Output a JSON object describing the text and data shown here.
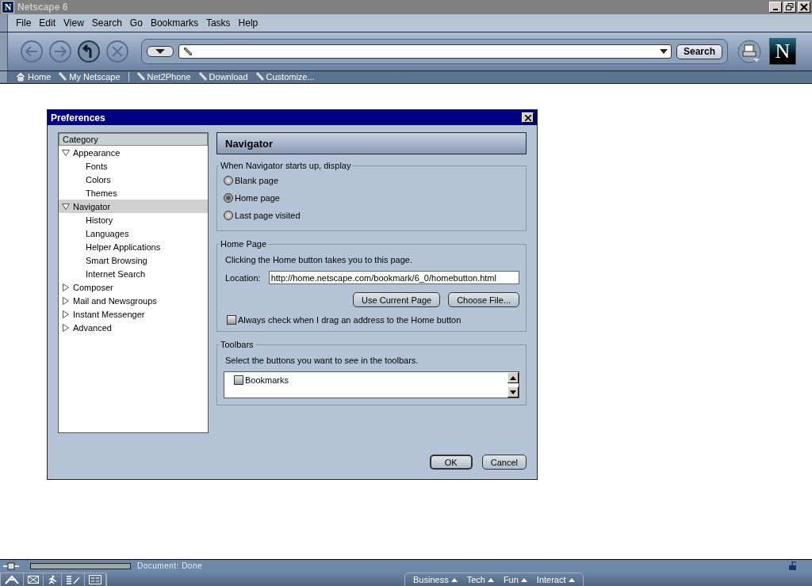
{
  "window": {
    "title": "Netscape 6",
    "logo_letter": "N"
  },
  "brand_logo_letter": "N",
  "progress": {
    "level": 1
  },
  "menu": [
    "File",
    "Edit",
    "View",
    "Search",
    "Go",
    "Bookmarks",
    "Tasks",
    "Help"
  ],
  "search_button": "Search",
  "personal_toolbar": [
    {
      "label": "Home",
      "kind": "home"
    },
    {
      "label": "My Netscape",
      "kind": "bookmark"
    },
    {
      "label": "Net2Phone",
      "kind": "bookmark"
    },
    {
      "label": "Download",
      "kind": "bookmark"
    },
    {
      "label": "Customize...",
      "kind": "bookmark"
    }
  ],
  "dialog": {
    "title": "Preferences",
    "category_header": "Category",
    "tree": [
      {
        "label": "Appearance",
        "expanded": true,
        "selected": false,
        "children": [
          {
            "label": "Fonts",
            "selected": false
          },
          {
            "label": "Colors",
            "selected": false
          },
          {
            "label": "Themes",
            "selected": false
          }
        ]
      },
      {
        "label": "Navigator",
        "expanded": true,
        "selected": true,
        "children": [
          {
            "label": "History",
            "selected": false
          },
          {
            "label": "Languages",
            "selected": false
          },
          {
            "label": "Helper Applications",
            "selected": false
          },
          {
            "label": "Smart Browsing",
            "selected": false
          },
          {
            "label": "Internet Search",
            "selected": false
          }
        ]
      },
      {
        "label": "Composer",
        "expanded": false,
        "selected": false
      },
      {
        "label": "Mail and Newsgroups",
        "expanded": false,
        "selected": false
      },
      {
        "label": "Instant Messenger",
        "expanded": false,
        "selected": false
      },
      {
        "label": "Advanced",
        "expanded": false,
        "selected": false
      }
    ],
    "panel_title": "Navigator",
    "startup": {
      "legend": "When Navigator starts up, display",
      "options": [
        {
          "label": "Blank page",
          "selected": false
        },
        {
          "label": "Home page",
          "selected": true
        },
        {
          "label": "Last page visited",
          "selected": false
        }
      ]
    },
    "home_page": {
      "legend": "Home Page",
      "description": "Clicking the Home button takes you to this page.",
      "location_label": "Location:",
      "location_value": "http://home.netscape.com/bookmark/6_0/homebutton.html",
      "buttons": [
        "Use Current Page",
        "Choose File..."
      ],
      "checkbox": {
        "label": "Always check when I drag an address to the Home button",
        "checked": false
      }
    },
    "toolbars": {
      "legend": "Toolbars",
      "description": "Select the buttons you want to see in the toolbars.",
      "items": [
        {
          "label": "Bookmarks",
          "checked": false
        }
      ]
    },
    "buttons": [
      "OK",
      "Cancel"
    ]
  },
  "status_bar": {
    "text": "Document: Done",
    "tabs": [
      "Business",
      "Tech",
      "Fun",
      "Interact"
    ]
  }
}
